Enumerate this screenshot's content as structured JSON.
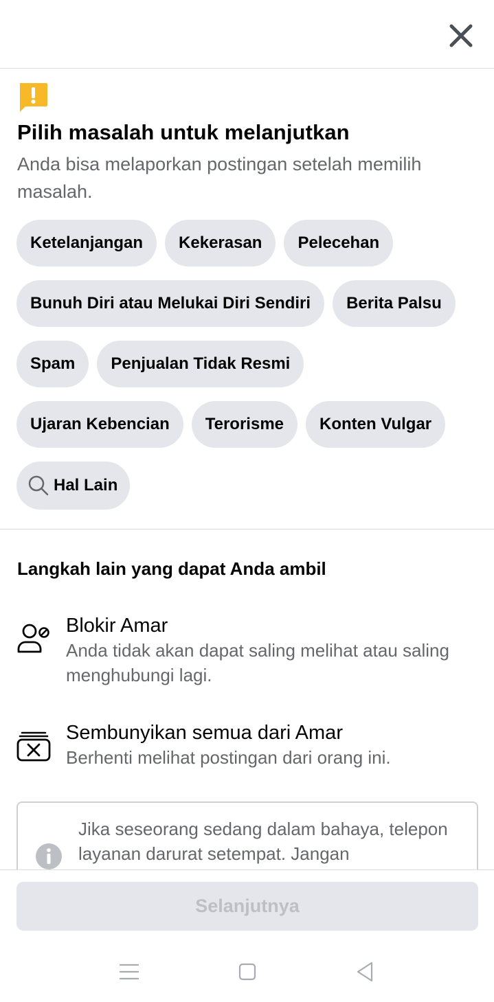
{
  "header": {
    "close_icon": "close-icon"
  },
  "report": {
    "alert_icon": "alert-icon",
    "title": "Pilih masalah untuk melanjutkan",
    "subtitle": "Anda bisa melaporkan postingan setelah memilih masalah.",
    "chips": [
      [
        "Ketelanjangan",
        "Kekerasan",
        "Pelecehan"
      ],
      [
        "Bunuh Diri atau Melukai Diri Sendiri",
        "Berita Palsu"
      ],
      [
        "Spam",
        "Penjualan Tidak Resmi"
      ],
      [
        "Ujaran Kebencian",
        "Terorisme",
        "Konten Vulgar"
      ]
    ],
    "other_chip": "Hal Lain"
  },
  "other_steps": {
    "title": "Langkah lain yang dapat Anda ambil",
    "actions": [
      {
        "icon": "block-user-icon",
        "title": "Blokir Amar",
        "description": "Anda tidak akan dapat saling melihat atau saling menghubungi lagi."
      },
      {
        "icon": "hide-all-icon",
        "title": "Sembunyikan semua dari Amar",
        "description": "Berhenti melihat postingan dari orang ini."
      }
    ]
  },
  "info": {
    "icon": "info-icon",
    "text": "Jika seseorang sedang dalam bahaya, telepon layanan darurat setempat. Jangan"
  },
  "footer": {
    "next_label": "Selanjutnya"
  },
  "system_nav": {
    "menu_icon": "menu-icon",
    "home_icon": "home-icon",
    "back_icon": "back-icon"
  },
  "colors": {
    "alert": "#f7b928",
    "chip_bg": "#e4e6eb",
    "secondary_text": "#65676b",
    "disabled_text": "#bcc0c4"
  }
}
